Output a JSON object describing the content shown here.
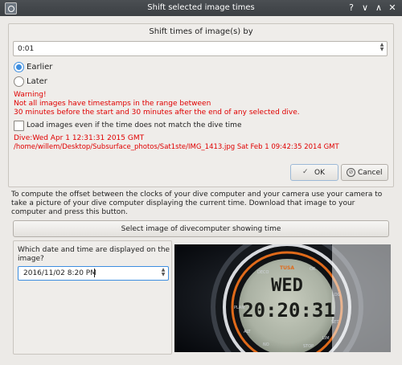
{
  "window": {
    "title": "Shift selected image times",
    "controls": [
      "?",
      "∨",
      "∧",
      "✕"
    ]
  },
  "shift": {
    "heading": "Shift times of image(s) by",
    "value": "0:01",
    "earlier_label": "Earlier",
    "later_label": "Later",
    "earlier_selected": true
  },
  "warning": {
    "line1": "Warning!",
    "line2": "Not all images have timestamps in the range between",
    "line3": "30 minutes before the start and 30 minutes after the end of any selected dive."
  },
  "load_checkbox": {
    "label": "Load images even if the time does not match the dive time",
    "checked": false
  },
  "dive_info": {
    "line1": "Dive:Wed Apr 1 12:31:31 2015 GMT",
    "line2": "/home/willem/Desktop/Subsurface_photos/Sat1ste/IMG_1413.jpg Sat Feb 1 09:42:35 2014 GMT"
  },
  "buttons": {
    "ok": "OK",
    "cancel": "Cancel",
    "select_image": "Select image of divecomputer showing time"
  },
  "instructions": {
    "line1": "To compute the offset between the clocks of your dive computer and your camera use your camera to",
    "line2": "take a picture of your dive computer displaying the current time. Download that image to your",
    "line3": "computer and press this button."
  },
  "datetime": {
    "question_line1": "Which date and time are displayed on the",
    "question_line2": "image?",
    "value": "2016/11/02 8:20 PM"
  },
  "photo": {
    "brand": "TUSA",
    "day": "WED",
    "time": "20:20:31",
    "ring_labels": [
      "DECO",
      "OK",
      "LOG",
      "PLAN",
      "SET",
      "ALT",
      "LIM",
      "NO",
      "STOP"
    ]
  }
}
